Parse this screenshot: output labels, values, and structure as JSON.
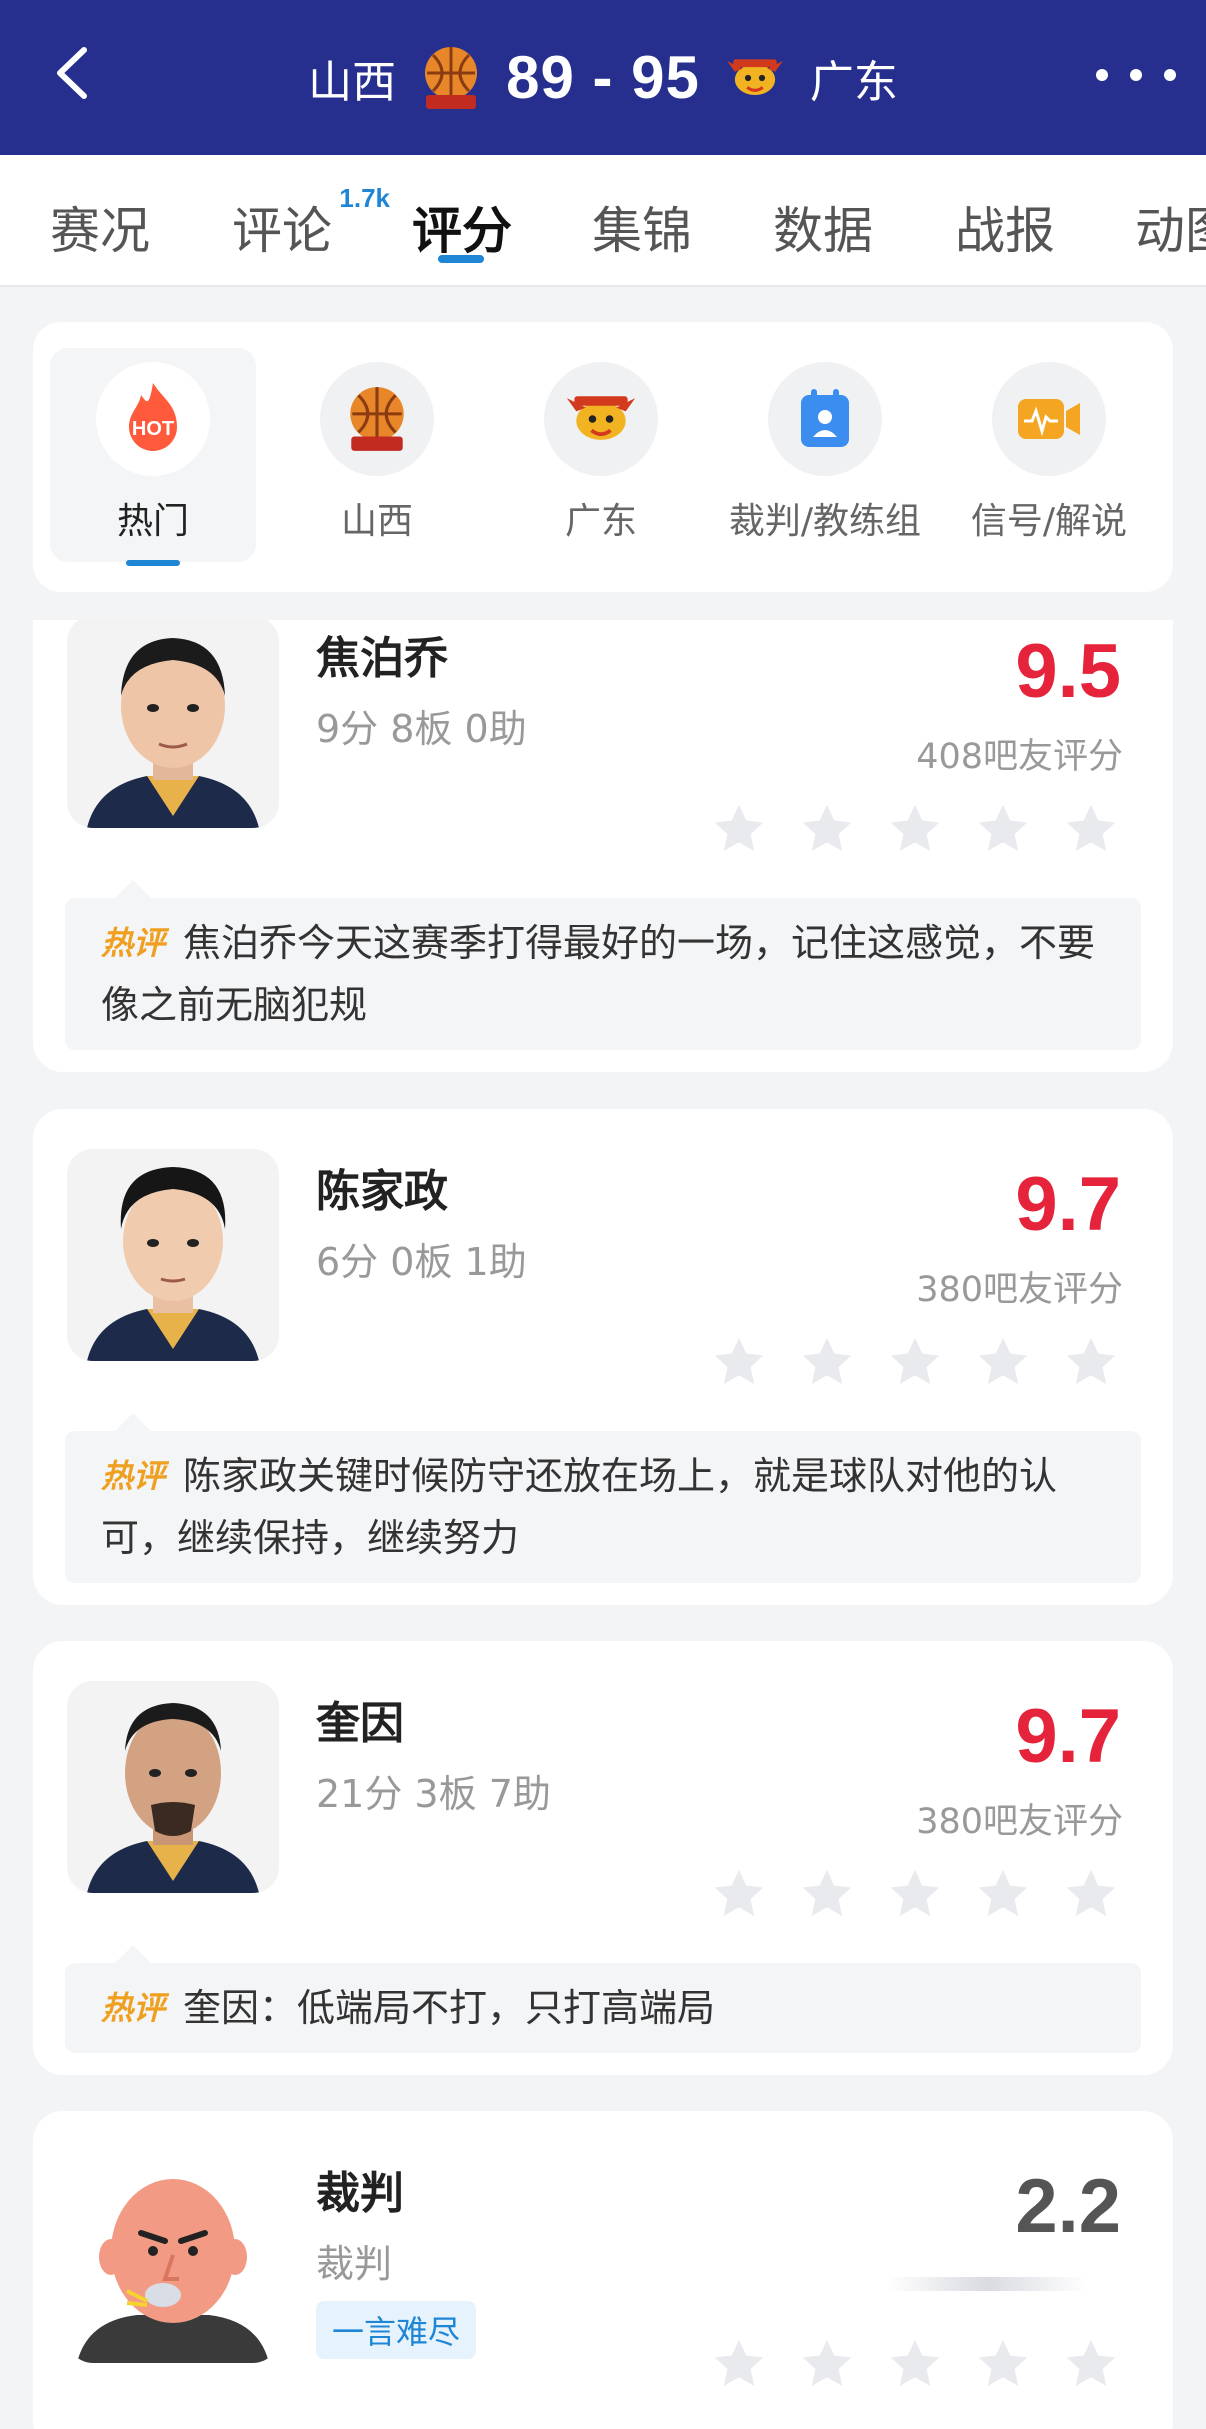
{
  "header": {
    "home_team": "山西",
    "away_team": "广东",
    "score": "89 - 95"
  },
  "tabs": [
    {
      "label": "赛况"
    },
    {
      "label": "评论",
      "badge": "1.7k"
    },
    {
      "label": "评分"
    },
    {
      "label": "集锦"
    },
    {
      "label": "数据"
    },
    {
      "label": "战报"
    },
    {
      "label": "动图"
    }
  ],
  "filters": [
    {
      "label": "热门",
      "icon": "hot-fire-icon"
    },
    {
      "label": "山西",
      "icon": "shanxi-logo-icon"
    },
    {
      "label": "广东",
      "icon": "guangdong-logo-icon"
    },
    {
      "label": "裁判/教练组",
      "icon": "referee-badge-icon"
    },
    {
      "label": "信号/解说",
      "icon": "broadcast-icon"
    }
  ],
  "players": [
    {
      "name": "焦泊乔",
      "stats": "9分 8板 0助",
      "rating": "9.5",
      "count": "408吧友评分",
      "comment_tag": "热评",
      "comment": "焦泊乔今天这赛季打得最好的一场，记住这感觉，不要像之前无脑犯规"
    },
    {
      "name": "陈家政",
      "stats": "6分 0板 1助",
      "rating": "9.7",
      "count": "380吧友评分",
      "comment_tag": "热评",
      "comment": "陈家政关键时候防守还放在场上，就是球队对他的认可，继续保持，继续努力"
    },
    {
      "name": "奎因",
      "stats": "21分 3板 7助",
      "rating": "9.7",
      "count": "380吧友评分",
      "comment_tag": "热评",
      "comment": "奎因：低端局不打，只打高端局"
    },
    {
      "name": "裁判",
      "stats": "裁判",
      "rating": "2.2",
      "tag": "一言难尽"
    }
  ],
  "colors": {
    "header_bg": "#262f8e",
    "accent_blue": "#1f86d6",
    "rating_red": "#e5233a",
    "hot_orange": "#f0a020"
  }
}
